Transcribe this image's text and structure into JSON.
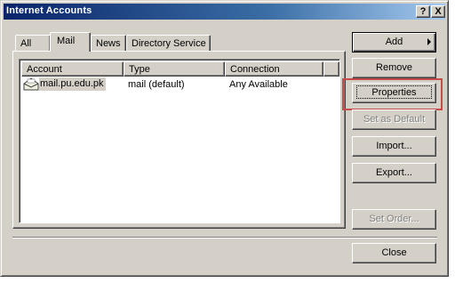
{
  "window": {
    "title": "Internet Accounts",
    "help_glyph": "?",
    "close_glyph": "X"
  },
  "tabs": [
    {
      "label": "All",
      "active": false
    },
    {
      "label": "Mail",
      "active": true
    },
    {
      "label": "News",
      "active": false
    },
    {
      "label": "Directory Service",
      "active": false
    }
  ],
  "list": {
    "columns": [
      "Account",
      "Type",
      "Connection"
    ],
    "rows": [
      {
        "account": "mail.pu.edu.pk",
        "type": "mail (default)",
        "connection": "Any Available",
        "icon": "mail-account-icon",
        "selected": true
      }
    ]
  },
  "buttons": {
    "add": "Add",
    "remove": "Remove",
    "properties": "Properties",
    "set_default": "Set as Default",
    "import": "Import...",
    "export": "Export...",
    "set_order": "Set Order...",
    "close": "Close"
  },
  "colors": {
    "dialog_face": "#d4d0c8",
    "title_start": "#0a246a",
    "title_end": "#a6caf0",
    "annotation_box": "#c84b4b"
  }
}
